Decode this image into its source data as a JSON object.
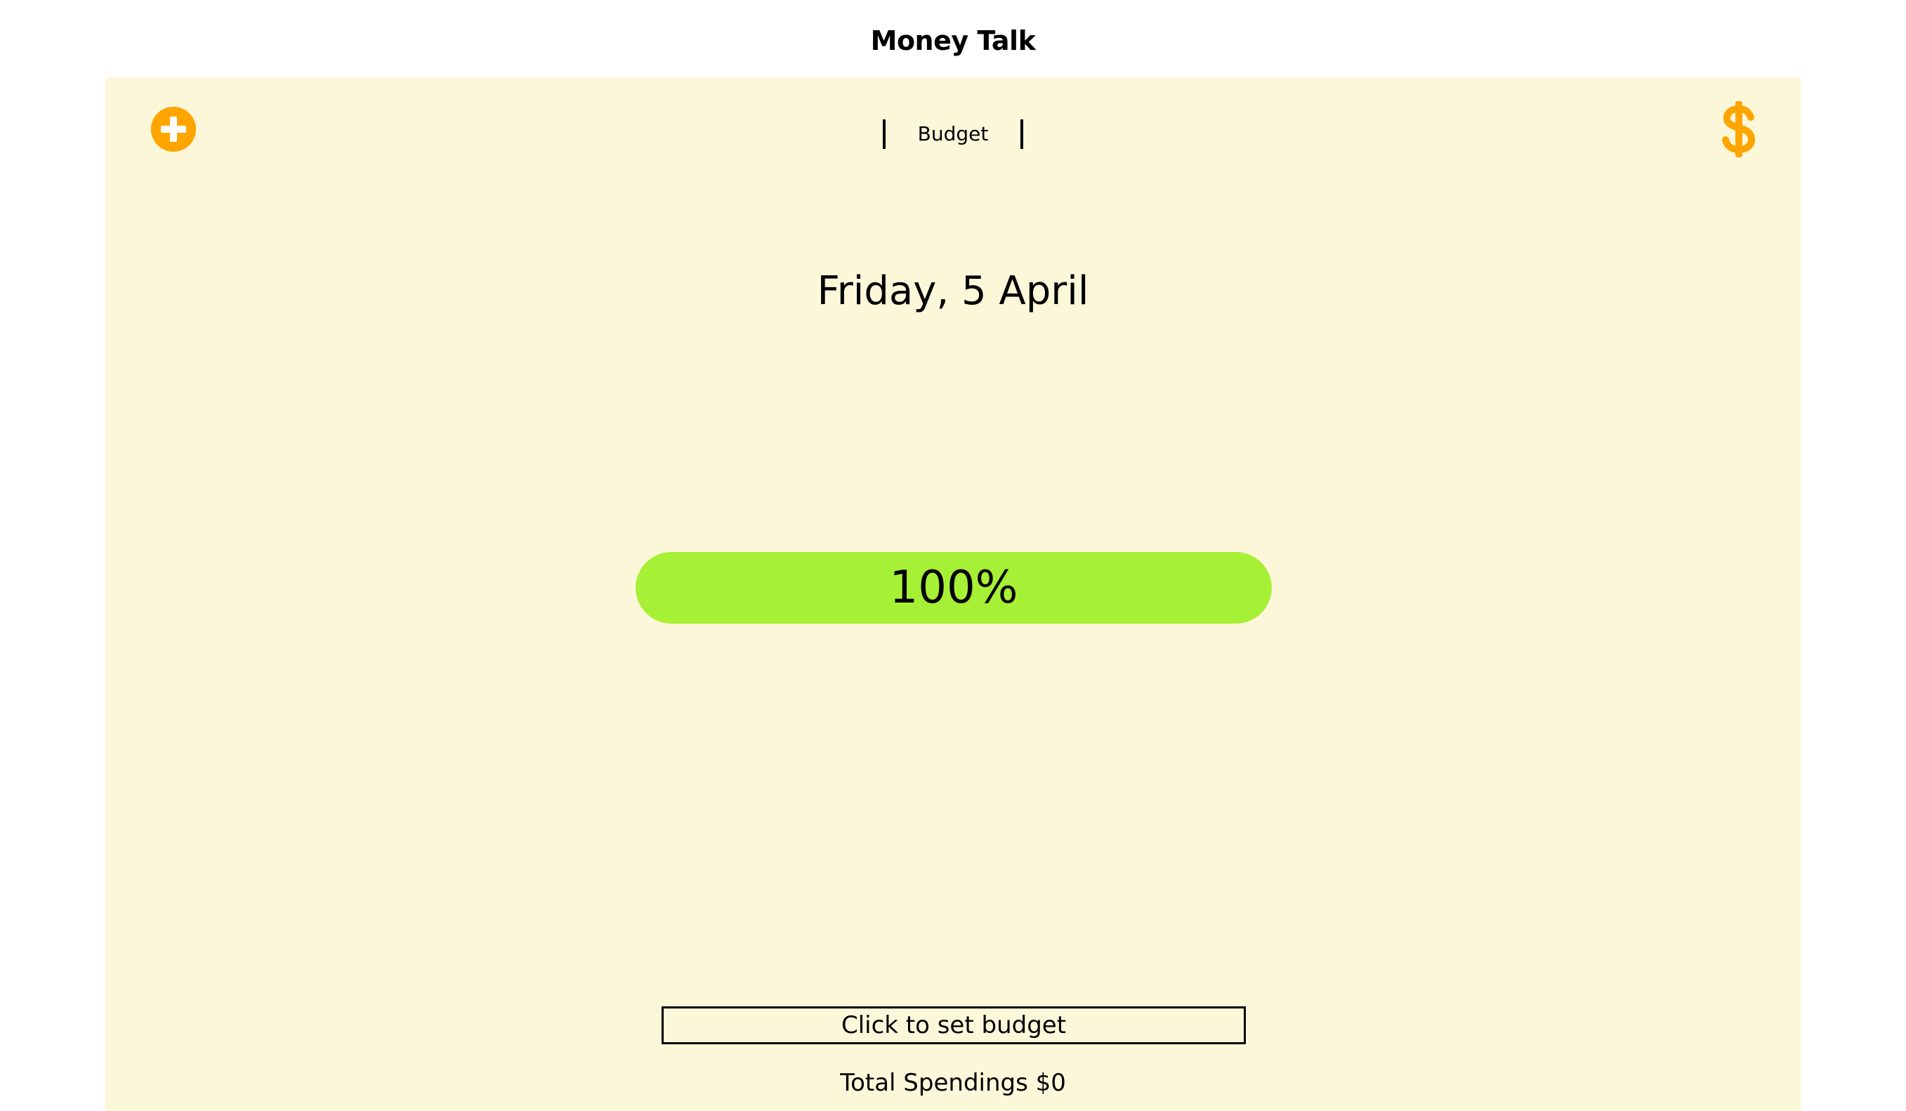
{
  "app": {
    "title": "Money Talk"
  },
  "header": {
    "add_icon": "plus-circle-icon",
    "nav_link": "Budget",
    "dollar_icon": "dollar-sign-icon"
  },
  "main": {
    "date": "Friday, 5 April",
    "budget_remaining_percent": 100,
    "progress_label": "100%",
    "set_budget_label": "Click to set budget",
    "total_spendings_label": "Total Spendings $0"
  },
  "colors": {
    "page_background": "#ffffff",
    "panel_background": "#fdf7da",
    "accent": "#ffa500",
    "progress_fill": "#a6f035",
    "text": "#000000"
  }
}
